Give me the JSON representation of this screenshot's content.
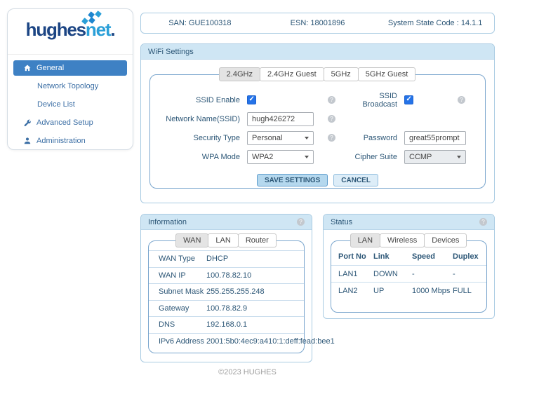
{
  "colors": {
    "accent": "#3e81c4",
    "panel_header_bg": "#cfe6f4",
    "checkbox_blue": "#2573e8",
    "sidebar_link": "#3c6fa5",
    "navy_text": "#2d5777"
  },
  "topbar": {
    "san": "SAN: GUE100318",
    "esn": "ESN: 18001896",
    "system_state": "System State Code : 14.1.1"
  },
  "sidebar": {
    "logo": {
      "part1": "hughes",
      "part2": "net",
      "dot": "."
    },
    "items": [
      {
        "label": "General",
        "icon": "home-icon",
        "active": true
      },
      {
        "label": "Network Topology",
        "icon": null,
        "active": false
      },
      {
        "label": "Device List",
        "icon": null,
        "active": false
      },
      {
        "label": "Advanced Setup",
        "icon": "wrench-icon",
        "active": false
      },
      {
        "label": "Administration",
        "icon": "person-icon",
        "active": false
      }
    ]
  },
  "wifi": {
    "title": "WiFi Settings",
    "tabs": [
      {
        "label": "2.4GHz",
        "active": true
      },
      {
        "label": "2.4GHz Guest",
        "active": false
      },
      {
        "label": "5GHz",
        "active": false
      },
      {
        "label": "5GHz Guest",
        "active": false
      }
    ],
    "fields": {
      "ssid_enable_label": "SSID Enable",
      "ssid_enable_checked": true,
      "ssid_broadcast_label": "SSID Broadcast",
      "ssid_broadcast_checked": true,
      "network_name_label": "Network Name(SSID)",
      "network_name_value": "hugh426272",
      "security_type_label": "Security Type",
      "security_type_value": "Personal",
      "password_label": "Password",
      "password_value": "great55prompt",
      "wpa_mode_label": "WPA Mode",
      "wpa_mode_value": "WPA2",
      "cipher_suite_label": "Cipher Suite",
      "cipher_suite_value": "CCMP"
    },
    "buttons": {
      "save": "SAVE SETTINGS",
      "cancel": "CANCEL"
    }
  },
  "information": {
    "title": "Information",
    "tabs": [
      {
        "label": "WAN",
        "active": true
      },
      {
        "label": "LAN",
        "active": false
      },
      {
        "label": "Router",
        "active": false
      }
    ],
    "rows": [
      {
        "label": "WAN Type",
        "value": "DHCP"
      },
      {
        "label": "WAN IP",
        "value": "100.78.82.10"
      },
      {
        "label": "Subnet Mask",
        "value": "255.255.255.248"
      },
      {
        "label": "Gateway",
        "value": "100.78.82.9"
      },
      {
        "label": "DNS",
        "value": "192.168.0.1"
      },
      {
        "label": "IPv6 Address",
        "value": "2001:5b0:4ec9:a410:1:deff:fead:bee1"
      }
    ]
  },
  "status": {
    "title": "Status",
    "tabs": [
      {
        "label": "LAN",
        "active": true
      },
      {
        "label": "Wireless",
        "active": false
      },
      {
        "label": "Devices",
        "active": false
      }
    ],
    "columns": [
      "Port No",
      "Link",
      "Speed",
      "Duplex"
    ],
    "rows": [
      [
        "LAN1",
        "DOWN",
        "-",
        "-"
      ],
      [
        "LAN2",
        "UP",
        "1000 Mbps",
        "FULL"
      ]
    ]
  },
  "footer": {
    "copyright": "©2023 HUGHES"
  }
}
